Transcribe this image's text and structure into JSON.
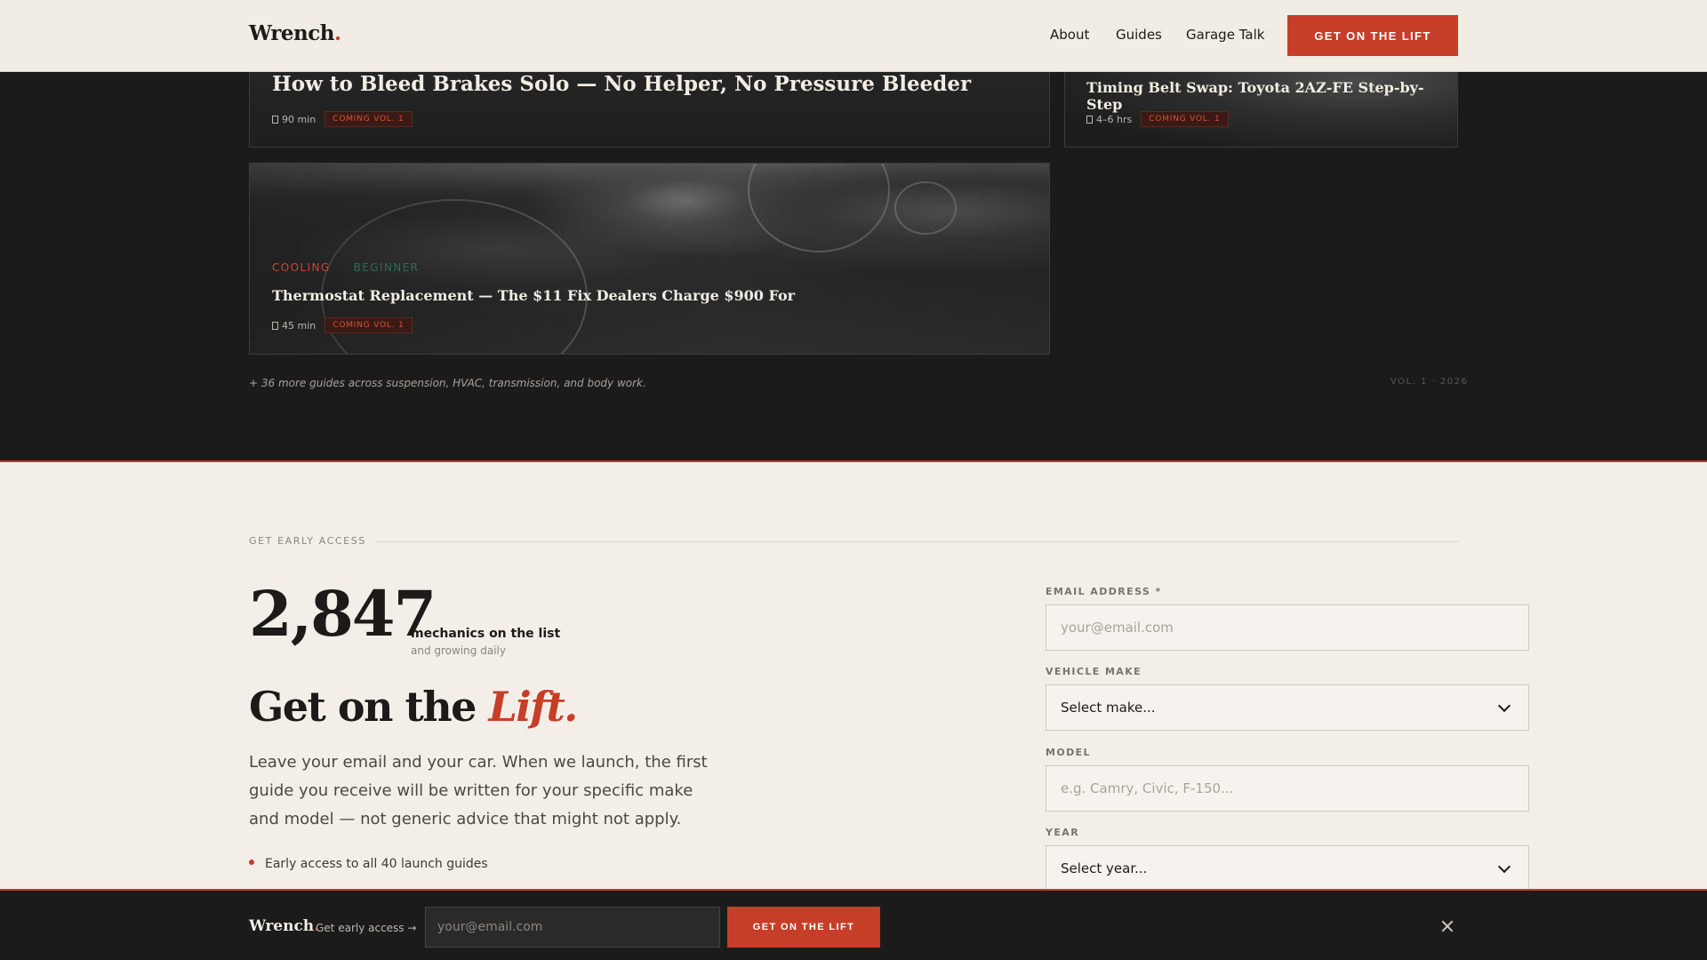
{
  "nav": {
    "logo": "Wrench",
    "logo_dot": ".",
    "links": [
      "About",
      "Guides",
      "Garage Talk"
    ],
    "cta": "GET ON THE LIFT"
  },
  "guides": {
    "cards": [
      {
        "title": "How to Bleed Brakes Solo — No Helper, No Pressure Bleeder",
        "time": "90 min",
        "badge": "COMING VOL. 1"
      },
      {
        "title": "Timing Belt Swap: Toyota 2AZ-FE Step-by-Step",
        "time": "4–6 hrs",
        "badge": "COMING VOL. 1"
      },
      {
        "title": "Thermostat Replacement — The $11 Fix Dealers Charge $900 For",
        "time": "45 min",
        "badge": "COMING VOL. 1",
        "category": "COOLING",
        "difficulty": "BEGINNER"
      }
    ],
    "more_note": "+ 36 more guides across suspension, HVAC, transmission, and body work.",
    "volume_note": "VOL. 1 · 2026"
  },
  "early_access": {
    "eyebrow": "GET EARLY ACCESS",
    "count": "2,847",
    "count_label": "mechanics on the list",
    "count_sub": "and growing daily",
    "headline_a": "Get on the ",
    "headline_b": "Lift.",
    "lede": "Leave your email and your car. When we launch, the first guide you receive will be written for your specific make and model — not generic advice that might not apply.",
    "bullets": [
      "Early access to all 40 launch guides"
    ]
  },
  "form": {
    "email_label": "EMAIL ADDRESS *",
    "email_placeholder": "your@email.com",
    "make_label": "VEHICLE MAKE",
    "make_value": "Select make...",
    "model_label": "MODEL",
    "model_placeholder": "e.g. Camry, Civic, F-150...",
    "year_label": "YEAR",
    "year_value": "Select year..."
  },
  "bottom_bar": {
    "logo": "Wrench",
    "logo_dot": ".",
    "tagline": "Get early access →",
    "email_placeholder": "your@email.com",
    "cta": "GET ON THE LIFT"
  },
  "colors": {
    "accent": "#c63e28",
    "dark": "#1b1b1b",
    "paper": "#f3efe8"
  }
}
